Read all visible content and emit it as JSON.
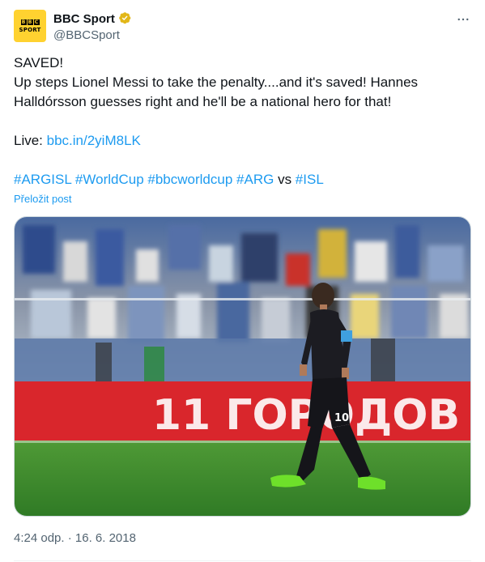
{
  "account": {
    "display_name": "BBC Sport",
    "handle": "@BBCSport",
    "avatar_logo_text": [
      "B",
      "B",
      "C"
    ],
    "avatar_sport_text": "SPORT",
    "verified_icon": "gold-check-badge-icon",
    "avatar_color": "#ffd230"
  },
  "menu": {
    "more_icon": "more-horizontal-icon"
  },
  "tweet": {
    "line1": "SAVED!",
    "line2": "Up steps Lionel Messi to take the penalty....and it's saved! Hannes Halldórsson guesses right and he'll be a national hero for that!",
    "live_label": "Live: ",
    "live_link": "bbc.in/2yiM8LK",
    "hashtags": {
      "h1": "#ARGISL",
      "h2": "#WorldCup",
      "h3": "#bbcworldcup",
      "h4": "#ARG",
      "vs": "vs",
      "h5": "#ISL"
    },
    "translate": "Přeložit post",
    "timestamp": "4:24 odp. · 16. 6. 2018"
  },
  "media": {
    "banner_text": "11 ГОРОДОВ",
    "jersey_number": "10"
  },
  "colors": {
    "link": "#1d9bf0",
    "secondary": "#536471",
    "text": "#0f1419",
    "banner_red": "#d9262c",
    "pitch_green": "#3f8a2e"
  }
}
